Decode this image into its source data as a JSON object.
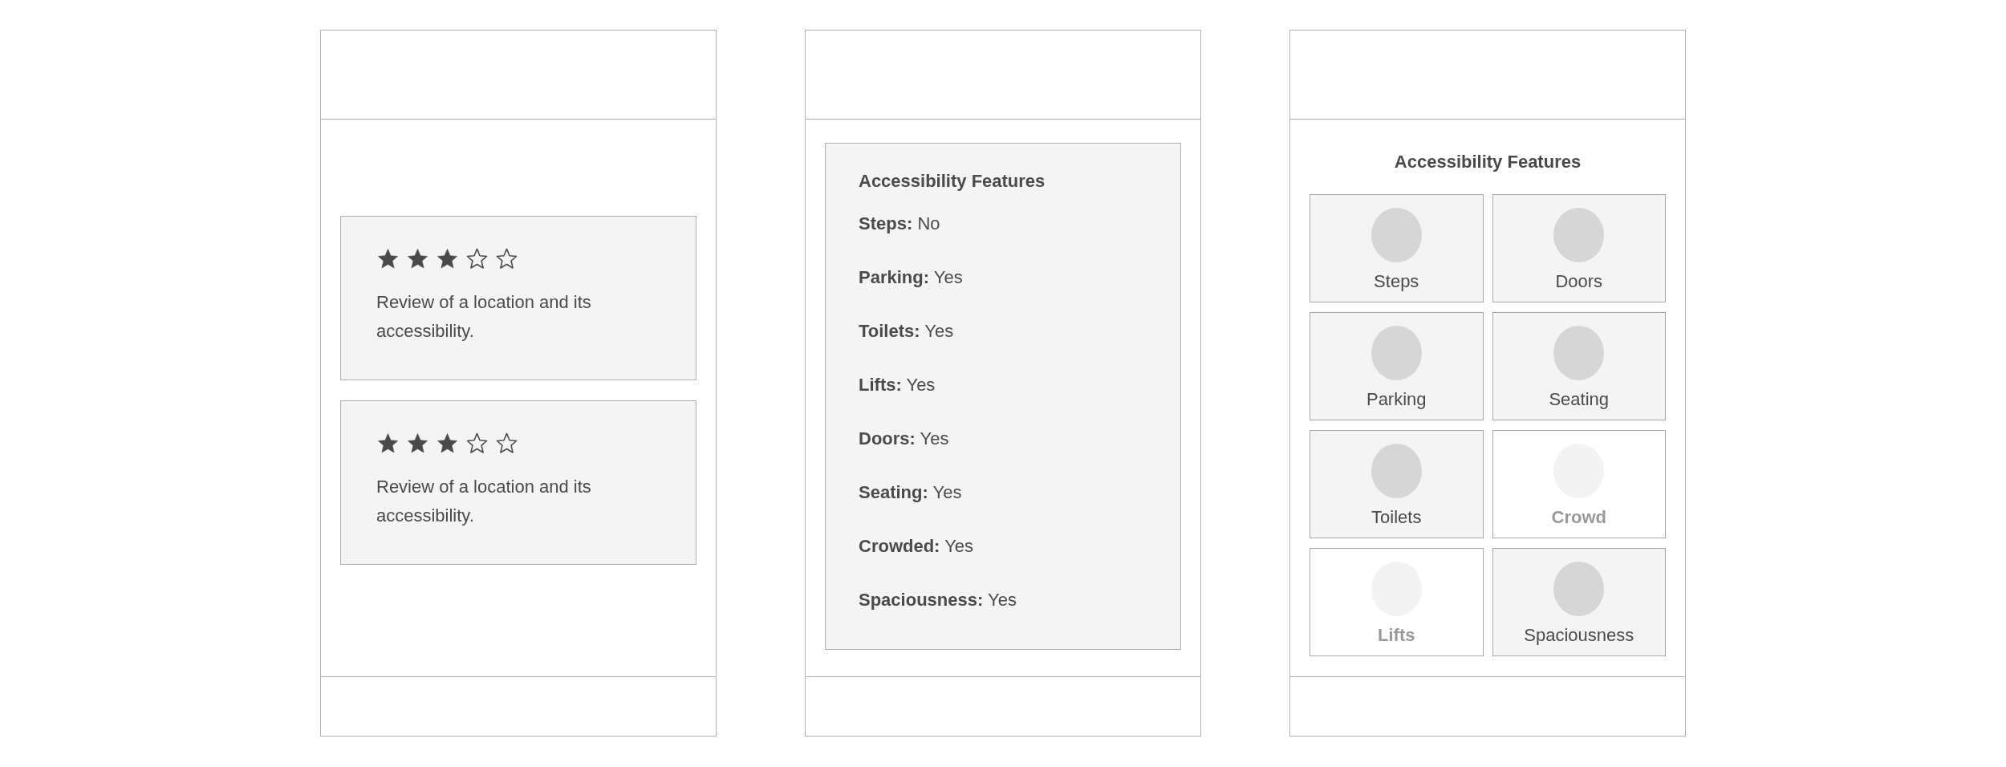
{
  "reviews_screen": {
    "reviews": [
      {
        "stars": 3,
        "text": "Review of a location and its accessibility."
      },
      {
        "stars": 3,
        "text": "Review of a location and its accessibility."
      }
    ]
  },
  "features_list_screen": {
    "title": "Accessibility Features",
    "features": [
      {
        "label": "Steps:",
        "value": "No"
      },
      {
        "label": "Parking:",
        "value": "Yes"
      },
      {
        "label": "Toilets:",
        "value": "Yes"
      },
      {
        "label": "Lifts:",
        "value": "Yes"
      },
      {
        "label": "Doors:",
        "value": "Yes"
      },
      {
        "label": "Seating:",
        "value": "Yes"
      },
      {
        "label": "Crowded:",
        "value": "Yes"
      },
      {
        "label": "Spaciousness:",
        "value": "Yes"
      }
    ]
  },
  "features_grid_screen": {
    "title": "Accessibility Features",
    "tiles": [
      {
        "label": "Steps",
        "disabled": false
      },
      {
        "label": "Doors",
        "disabled": false
      },
      {
        "label": "Parking",
        "disabled": false
      },
      {
        "label": "Seating",
        "disabled": false
      },
      {
        "label": "Toilets",
        "disabled": false
      },
      {
        "label": "Crowd",
        "disabled": true
      },
      {
        "label": "Lifts",
        "disabled": true
      },
      {
        "label": "Spaciousness",
        "disabled": false
      }
    ]
  }
}
